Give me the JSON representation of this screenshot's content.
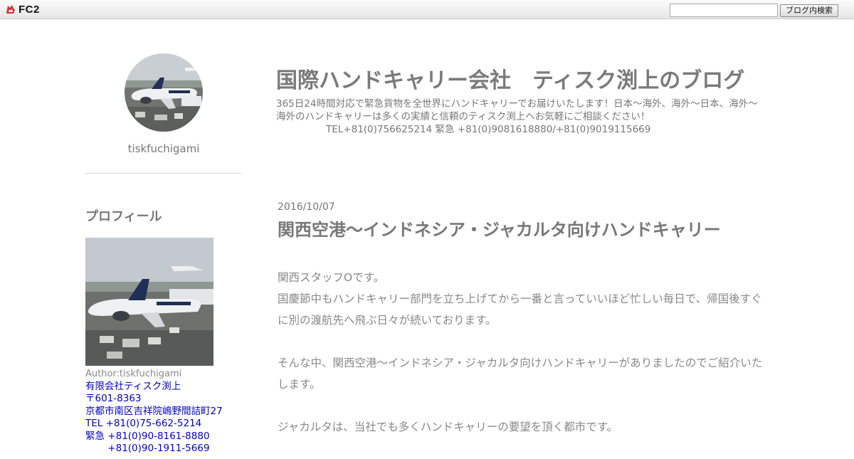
{
  "toolbar": {
    "logo_text": "FC2",
    "search_placeholder": "",
    "search_button_label": "ブログ内検索"
  },
  "sidebar": {
    "author_name": "tiskfuchigami",
    "profile_heading": "プロフィール",
    "author_line": "Author:tiskfuchigami",
    "info_lines": [
      "有限会社ティスク渕上",
      "〒601-8363",
      "京都市南区吉祥院嶋野間詰町27",
      "TEL +81(0)75-662-5214",
      "緊急 +81(0)90-8161-8880",
      "　　 +81(0)90-1911-5669"
    ]
  },
  "header": {
    "title": "国際ハンドキャリー会社　ティスク渕上のブログ",
    "description": "365日24時間対応で緊急貨物を全世界にハンドキャリーでお届けいたします！日本～海外、海外～日本、海外～海外のハンドキャリーは多くの実績と信頼のティスク渕上へお気軽にご相談ください！",
    "tel_line": "TEL+81(0)756625214 緊急 +81(0)9081618880/+81(0)9019115669"
  },
  "entry": {
    "date": "2016/10/07",
    "title": "関西空港～インドネシア・ジャカルタ向けハンドキャリー",
    "paragraphs": [
      "関西スタッフOです。",
      "国慶節中もハンドキャリー部門を立ち上げてから一番と言っていいほど忙しい毎日で、帰国後すぐに別の渡航先へ飛ぶ日々が続いております。",
      "そんな中、関西空港～インドネシア・ジャカルタ向けハンドキャリーがありましたのでご紹介いたします。",
      "ジャカルタは、当社でも多くハンドキャリーの要望を頂く都市です。"
    ]
  },
  "colors": {
    "link": "#0000cc",
    "title_text": "#7a7a7a",
    "body_text": "#888888"
  }
}
